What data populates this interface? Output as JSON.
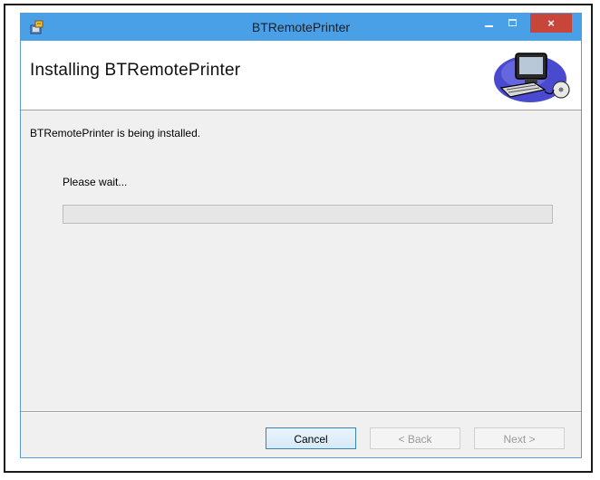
{
  "window": {
    "title": "BTRemotePrinter",
    "controls": {
      "minimize_icon": "minimize-icon",
      "maximize_icon": "maximize-icon",
      "close_label": "×"
    }
  },
  "header": {
    "title": "Installing BTRemotePrinter",
    "art_icon": "computer-installer-icon"
  },
  "content": {
    "status_text": "BTRemotePrinter is being installed.",
    "wait_label": "Please wait...",
    "progress_fraction": 0
  },
  "buttons": {
    "cancel": "Cancel",
    "back": "< Back",
    "next": "Next >"
  },
  "colors": {
    "titlebar": "#4aa0e6",
    "close_button": "#c7453a",
    "progress_fill": "#06b025"
  }
}
